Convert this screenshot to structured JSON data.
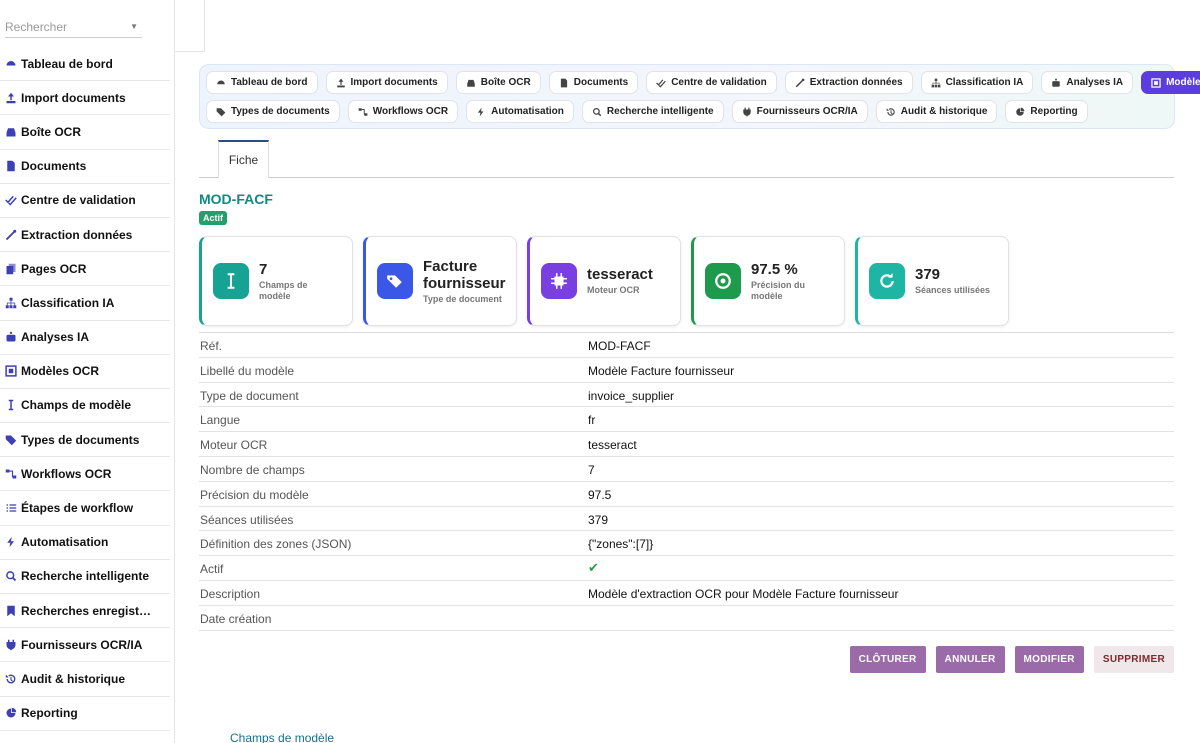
{
  "search": {
    "placeholder": "Rechercher"
  },
  "sidebar": {
    "items": [
      {
        "label": "Tableau de bord",
        "icon": "gauge-icon"
      },
      {
        "label": "Import documents",
        "icon": "upload-icon"
      },
      {
        "label": "Boîte OCR",
        "icon": "inbox-icon"
      },
      {
        "label": "Documents",
        "icon": "file-icon"
      },
      {
        "label": "Centre de validation",
        "icon": "check-double-icon"
      },
      {
        "label": "Extraction données",
        "icon": "magic-wand-icon"
      },
      {
        "label": "Pages OCR",
        "icon": "copy-icon"
      },
      {
        "label": "Classification IA",
        "icon": "sitemap-icon"
      },
      {
        "label": "Analyses IA",
        "icon": "robot-icon"
      },
      {
        "label": "Modèles OCR",
        "icon": "object-group-icon"
      },
      {
        "label": "Champs de modèle",
        "icon": "text-cursor-icon"
      },
      {
        "label": "Types de documents",
        "icon": "tags-icon"
      },
      {
        "label": "Workflows OCR",
        "icon": "diagram-icon"
      },
      {
        "label": "Étapes de workflow",
        "icon": "list-check-icon"
      },
      {
        "label": "Automatisation",
        "icon": "bolt-icon"
      },
      {
        "label": "Recherche intelligente",
        "icon": "search-icon"
      },
      {
        "label": "Recherches enregist…",
        "icon": "bookmark-icon"
      },
      {
        "label": "Fournisseurs OCR/IA",
        "icon": "plug-icon"
      },
      {
        "label": "Audit & historique",
        "icon": "history-icon"
      },
      {
        "label": "Reporting",
        "icon": "chart-pie-icon"
      }
    ]
  },
  "tabs": {
    "row1": [
      "Tableau de bord",
      "Import documents",
      "Boîte OCR",
      "Documents",
      "Centre de validation",
      "Extraction données",
      "Classification IA",
      "Analyses IA",
      "Modèles OCR"
    ],
    "row2": [
      "Types de documents",
      "Workflows OCR",
      "Automatisation",
      "Recherche intelligente",
      "Fournisseurs OCR/IA",
      "Audit & historique",
      "Reporting"
    ],
    "active": "Modèles OCR"
  },
  "subtab": {
    "label": "Fiche"
  },
  "record": {
    "title": "MOD-FACF",
    "status": "Actif"
  },
  "cards": [
    {
      "value": "7",
      "label": "Champs de modèle",
      "color": "#16a394"
    },
    {
      "value": "Facture fournisseur",
      "label": "Type de document",
      "color": "#3a57e8"
    },
    {
      "value": "tesseract",
      "label": "Moteur OCR",
      "color": "#7a3fe0"
    },
    {
      "value": "97.5 %",
      "label": "Précision du modèle",
      "color": "#1e9a4c"
    },
    {
      "value": "379",
      "label": "Séances utilisées",
      "color": "#1eb5a5"
    }
  ],
  "details": [
    {
      "key": "Réf.",
      "value": "MOD-FACF"
    },
    {
      "key": "Libellé du modèle",
      "value": "Modèle Facture fournisseur"
    },
    {
      "key": "Type de document",
      "value": "invoice_supplier"
    },
    {
      "key": "Langue",
      "value": "fr"
    },
    {
      "key": "Moteur OCR",
      "value": "tesseract"
    },
    {
      "key": "Nombre de champs",
      "value": "7"
    },
    {
      "key": "Précision du modèle",
      "value": "97.5"
    },
    {
      "key": "Séances utilisées",
      "value": "379"
    },
    {
      "key": "Définition des zones (JSON)",
      "value": "{\"zones\":[7]}"
    },
    {
      "key": "Actif",
      "value": "✔"
    },
    {
      "key": "Description",
      "value": "Modèle d'extraction OCR pour Modèle Facture fournisseur"
    },
    {
      "key": "Date création",
      "value": ""
    }
  ],
  "buttons": {
    "close": "CLÔTURER",
    "cancel": "ANNULER",
    "edit": "MODIFIER",
    "delete": "SUPPRIMER"
  },
  "related": {
    "link": "Champs de modèle"
  },
  "colors": {
    "accent": "#5b3de0",
    "teal": "#0f8a82",
    "button": "#9b6aa8"
  }
}
